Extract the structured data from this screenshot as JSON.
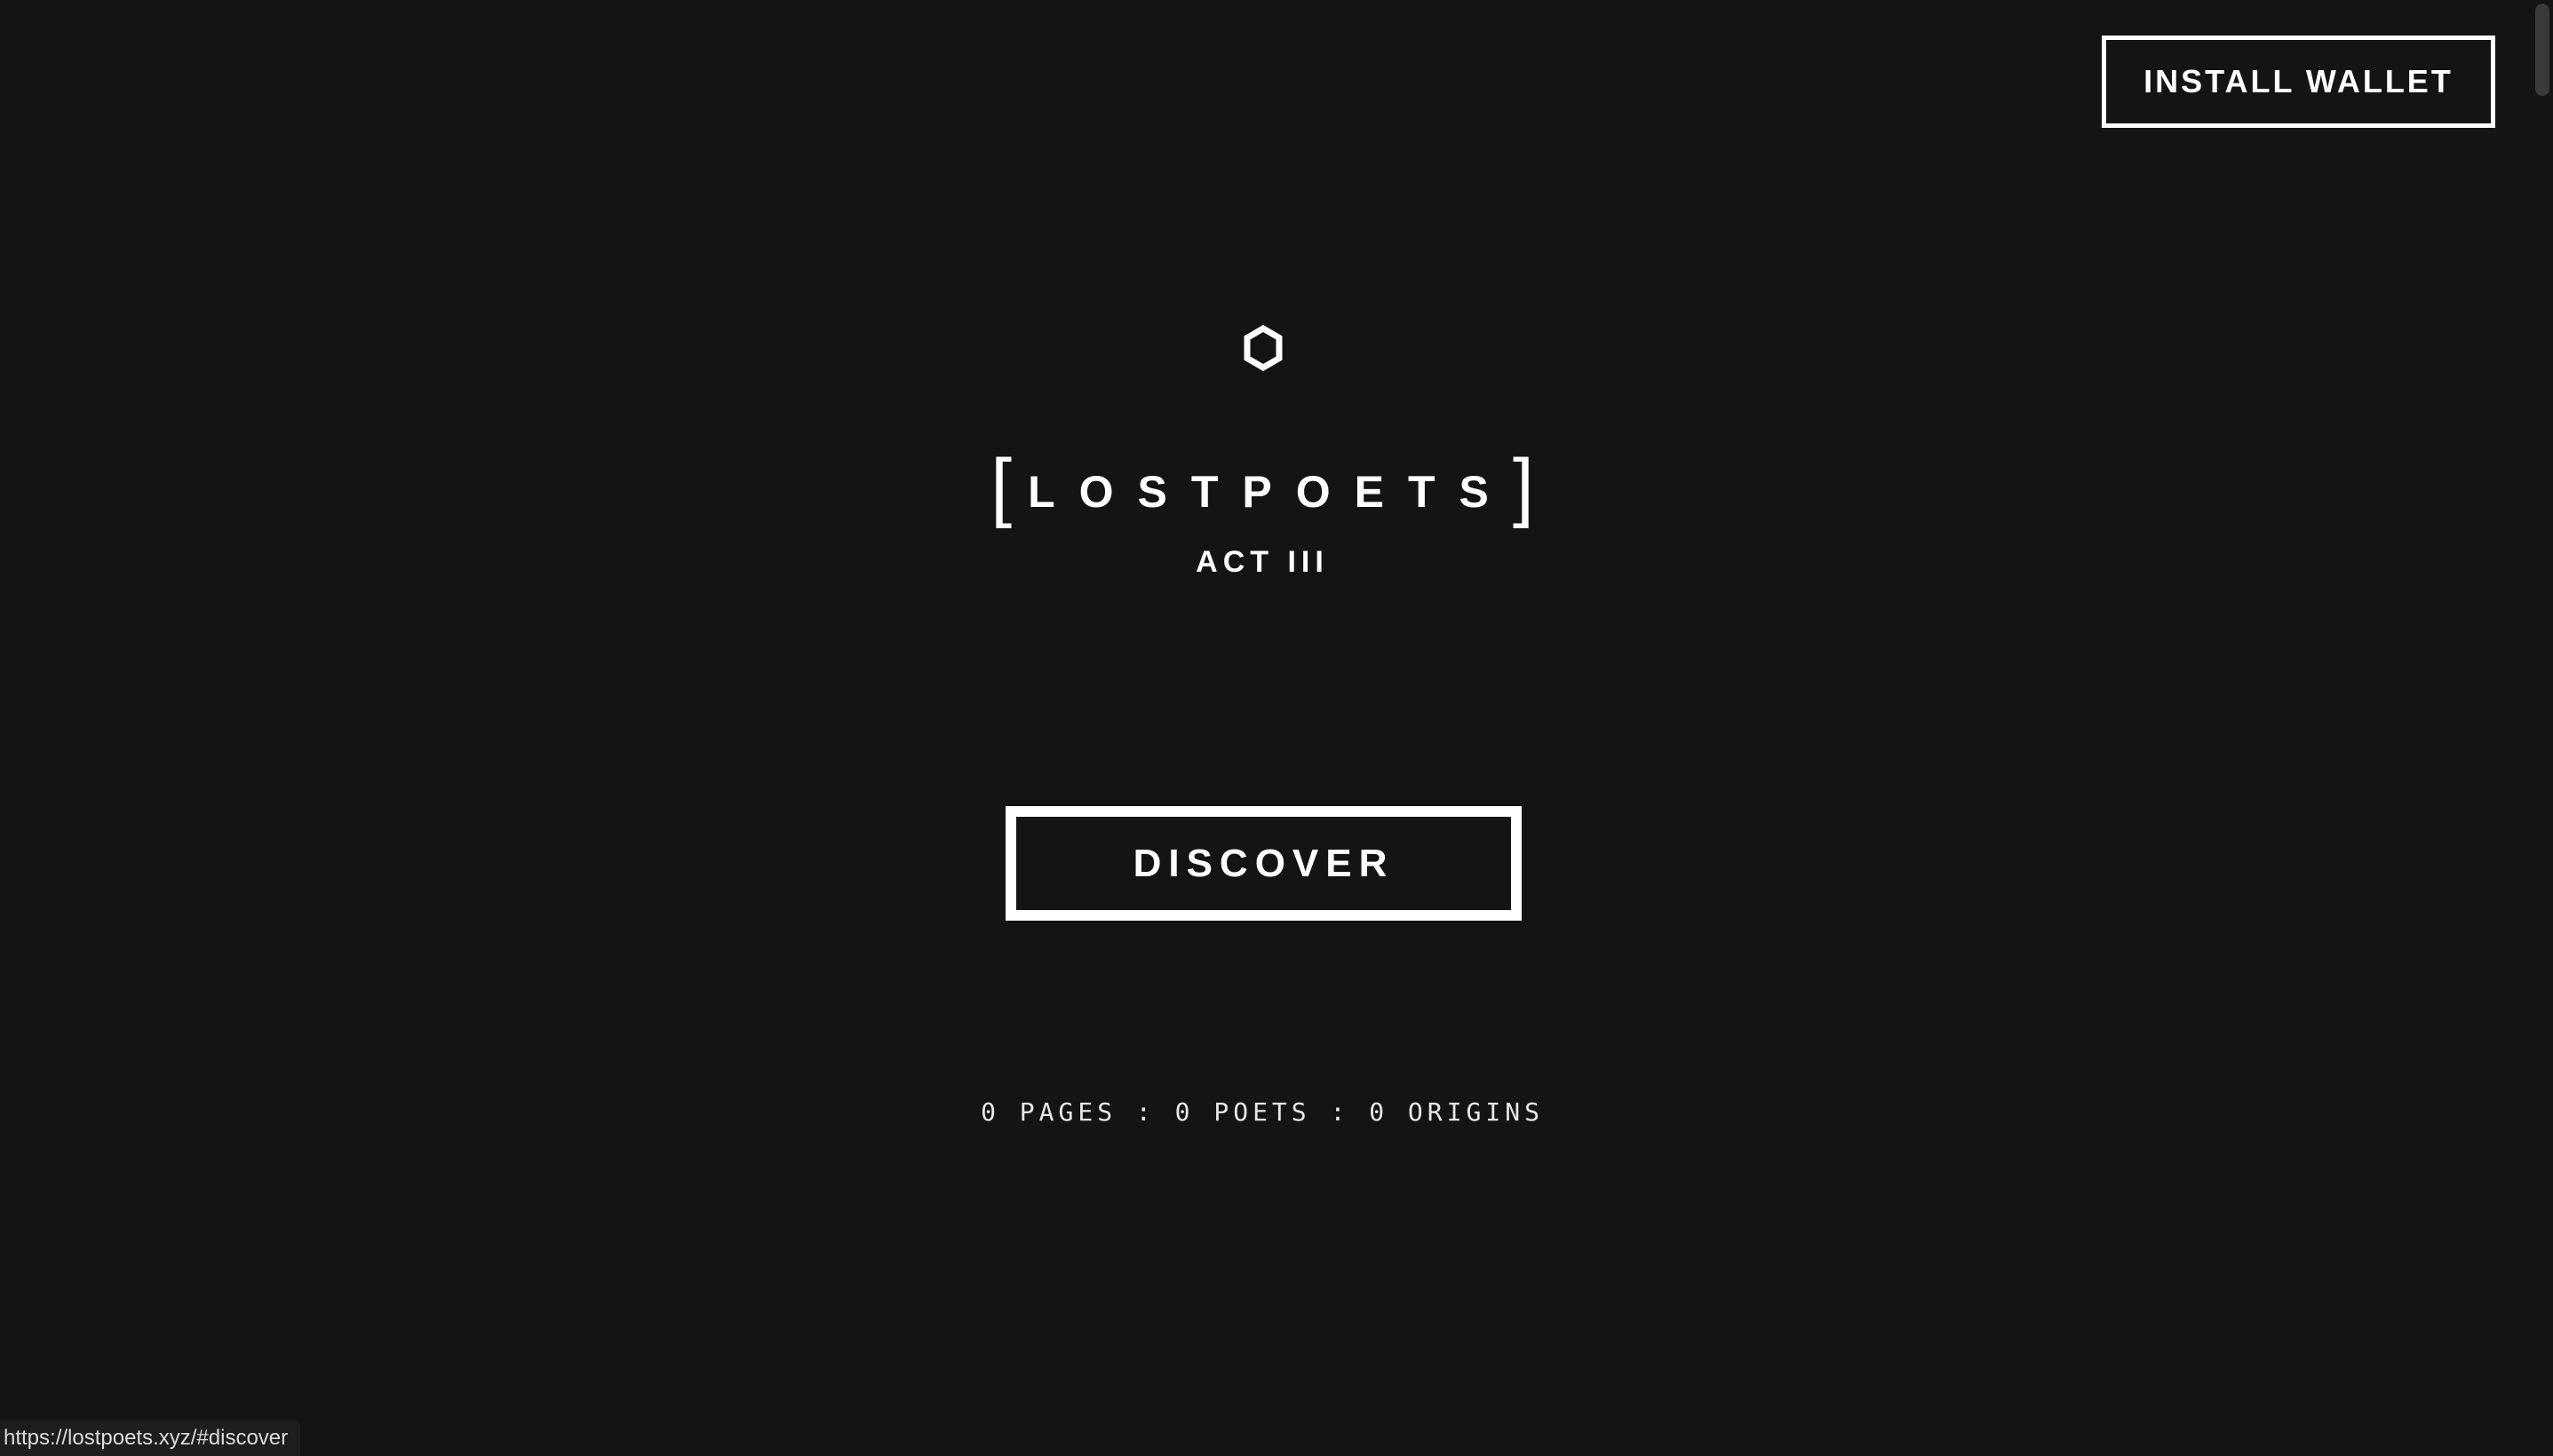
{
  "header": {
    "install_wallet_label": "INSTALL WALLET"
  },
  "brand": {
    "logo_icon": "hexagon-icon",
    "bracket_open": "[",
    "name": "LOSTPOETS",
    "bracket_close": "]",
    "subtitle": "ACT III"
  },
  "main": {
    "discover_label": "DISCOVER",
    "stats": "0 PAGES : 0 POETS : 0 ORIGINS"
  },
  "status_bar": {
    "url": "https://lostpoets.xyz/#discover"
  },
  "colors": {
    "background": "#141414",
    "foreground": "#ffffff"
  }
}
